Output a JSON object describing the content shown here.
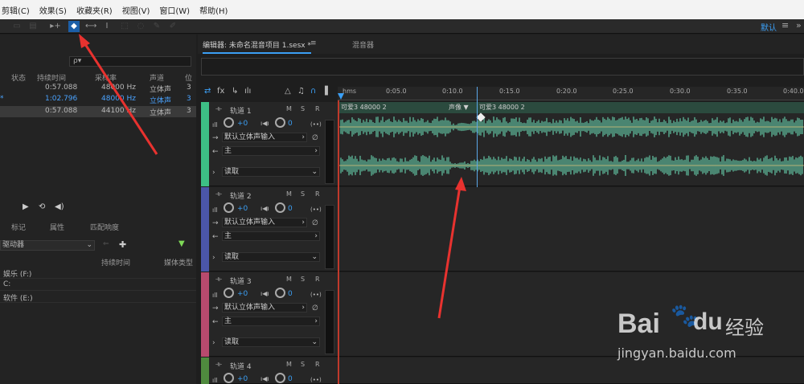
{
  "menu": [
    "剪辑(C)",
    "效果(S)",
    "收藏夹(R)",
    "视图(V)",
    "窗口(W)",
    "帮助(H)"
  ],
  "toolbar": {
    "workspace": "默认",
    "menu_icon": "≡",
    "more_icon": "»"
  },
  "left_panel": {
    "search_placeholder": "ρ▾",
    "file_headers": [
      "状态",
      "持续时间",
      "采样率",
      "声道",
      "位"
    ],
    "files": [
      {
        "status": "",
        "duration": "0:57.088",
        "rate": "48000 Hz",
        "channels": "立体声",
        "bits": "3"
      },
      {
        "status": "*",
        "duration": "1:02.796",
        "rate": "48000 Hz",
        "channels": "立体声",
        "bits": "3"
      },
      {
        "status": "",
        "duration": "0:57.088",
        "rate": "44100 Hz",
        "channels": "立体声",
        "bits": "3"
      }
    ],
    "tabs": [
      "标记",
      "属性",
      "匹配响度"
    ],
    "drive_select": "驱动器",
    "browser_headers": [
      "持续时间",
      "媒体类型"
    ],
    "drives": [
      "娱乐 (F:)",
      "C:",
      "软件 (E:)"
    ]
  },
  "editor": {
    "tab_label": "编辑器: 未命名混音项目 1.sesx *",
    "tab_menu": "≡",
    "mixer_label": "混音器",
    "ruler_unit": "hms",
    "ruler_labels": [
      "0:05.0",
      "0:10.0",
      "0:15.0",
      "0:20.0",
      "0:25.0",
      "0:30.0",
      "0:35.0",
      "0:40.0"
    ],
    "clip_left": "可爱3 48000 2",
    "clip_center": "声像 ▼",
    "clip_right": "可爱3 48000 2",
    "tracks": [
      {
        "name": "轨道 1",
        "vol": "+0",
        "pan": "0",
        "input": "默认立体声输入",
        "output": "主",
        "mode": "读取",
        "color": "#3dbf85"
      },
      {
        "name": "轨道 2",
        "vol": "+0",
        "pan": "0",
        "input": "默认立体声输入",
        "output": "主",
        "mode": "读取",
        "color": "#4b56a8"
      },
      {
        "name": "轨道 3",
        "vol": "+0",
        "pan": "0",
        "input": "默认立体声输入",
        "output": "主",
        "mode": "读取",
        "color": "#b84a6e"
      },
      {
        "name": "轨道 4",
        "vol": "+0",
        "pan": "0",
        "input": "",
        "output": "",
        "mode": "",
        "color": "#4f8a3e"
      }
    ],
    "track_buttons": [
      "M",
      "S",
      "R"
    ]
  },
  "watermark": {
    "brand": "Bai",
    "brand2": "du",
    "cn": "经验",
    "url": "jingyan.baidu.com"
  }
}
